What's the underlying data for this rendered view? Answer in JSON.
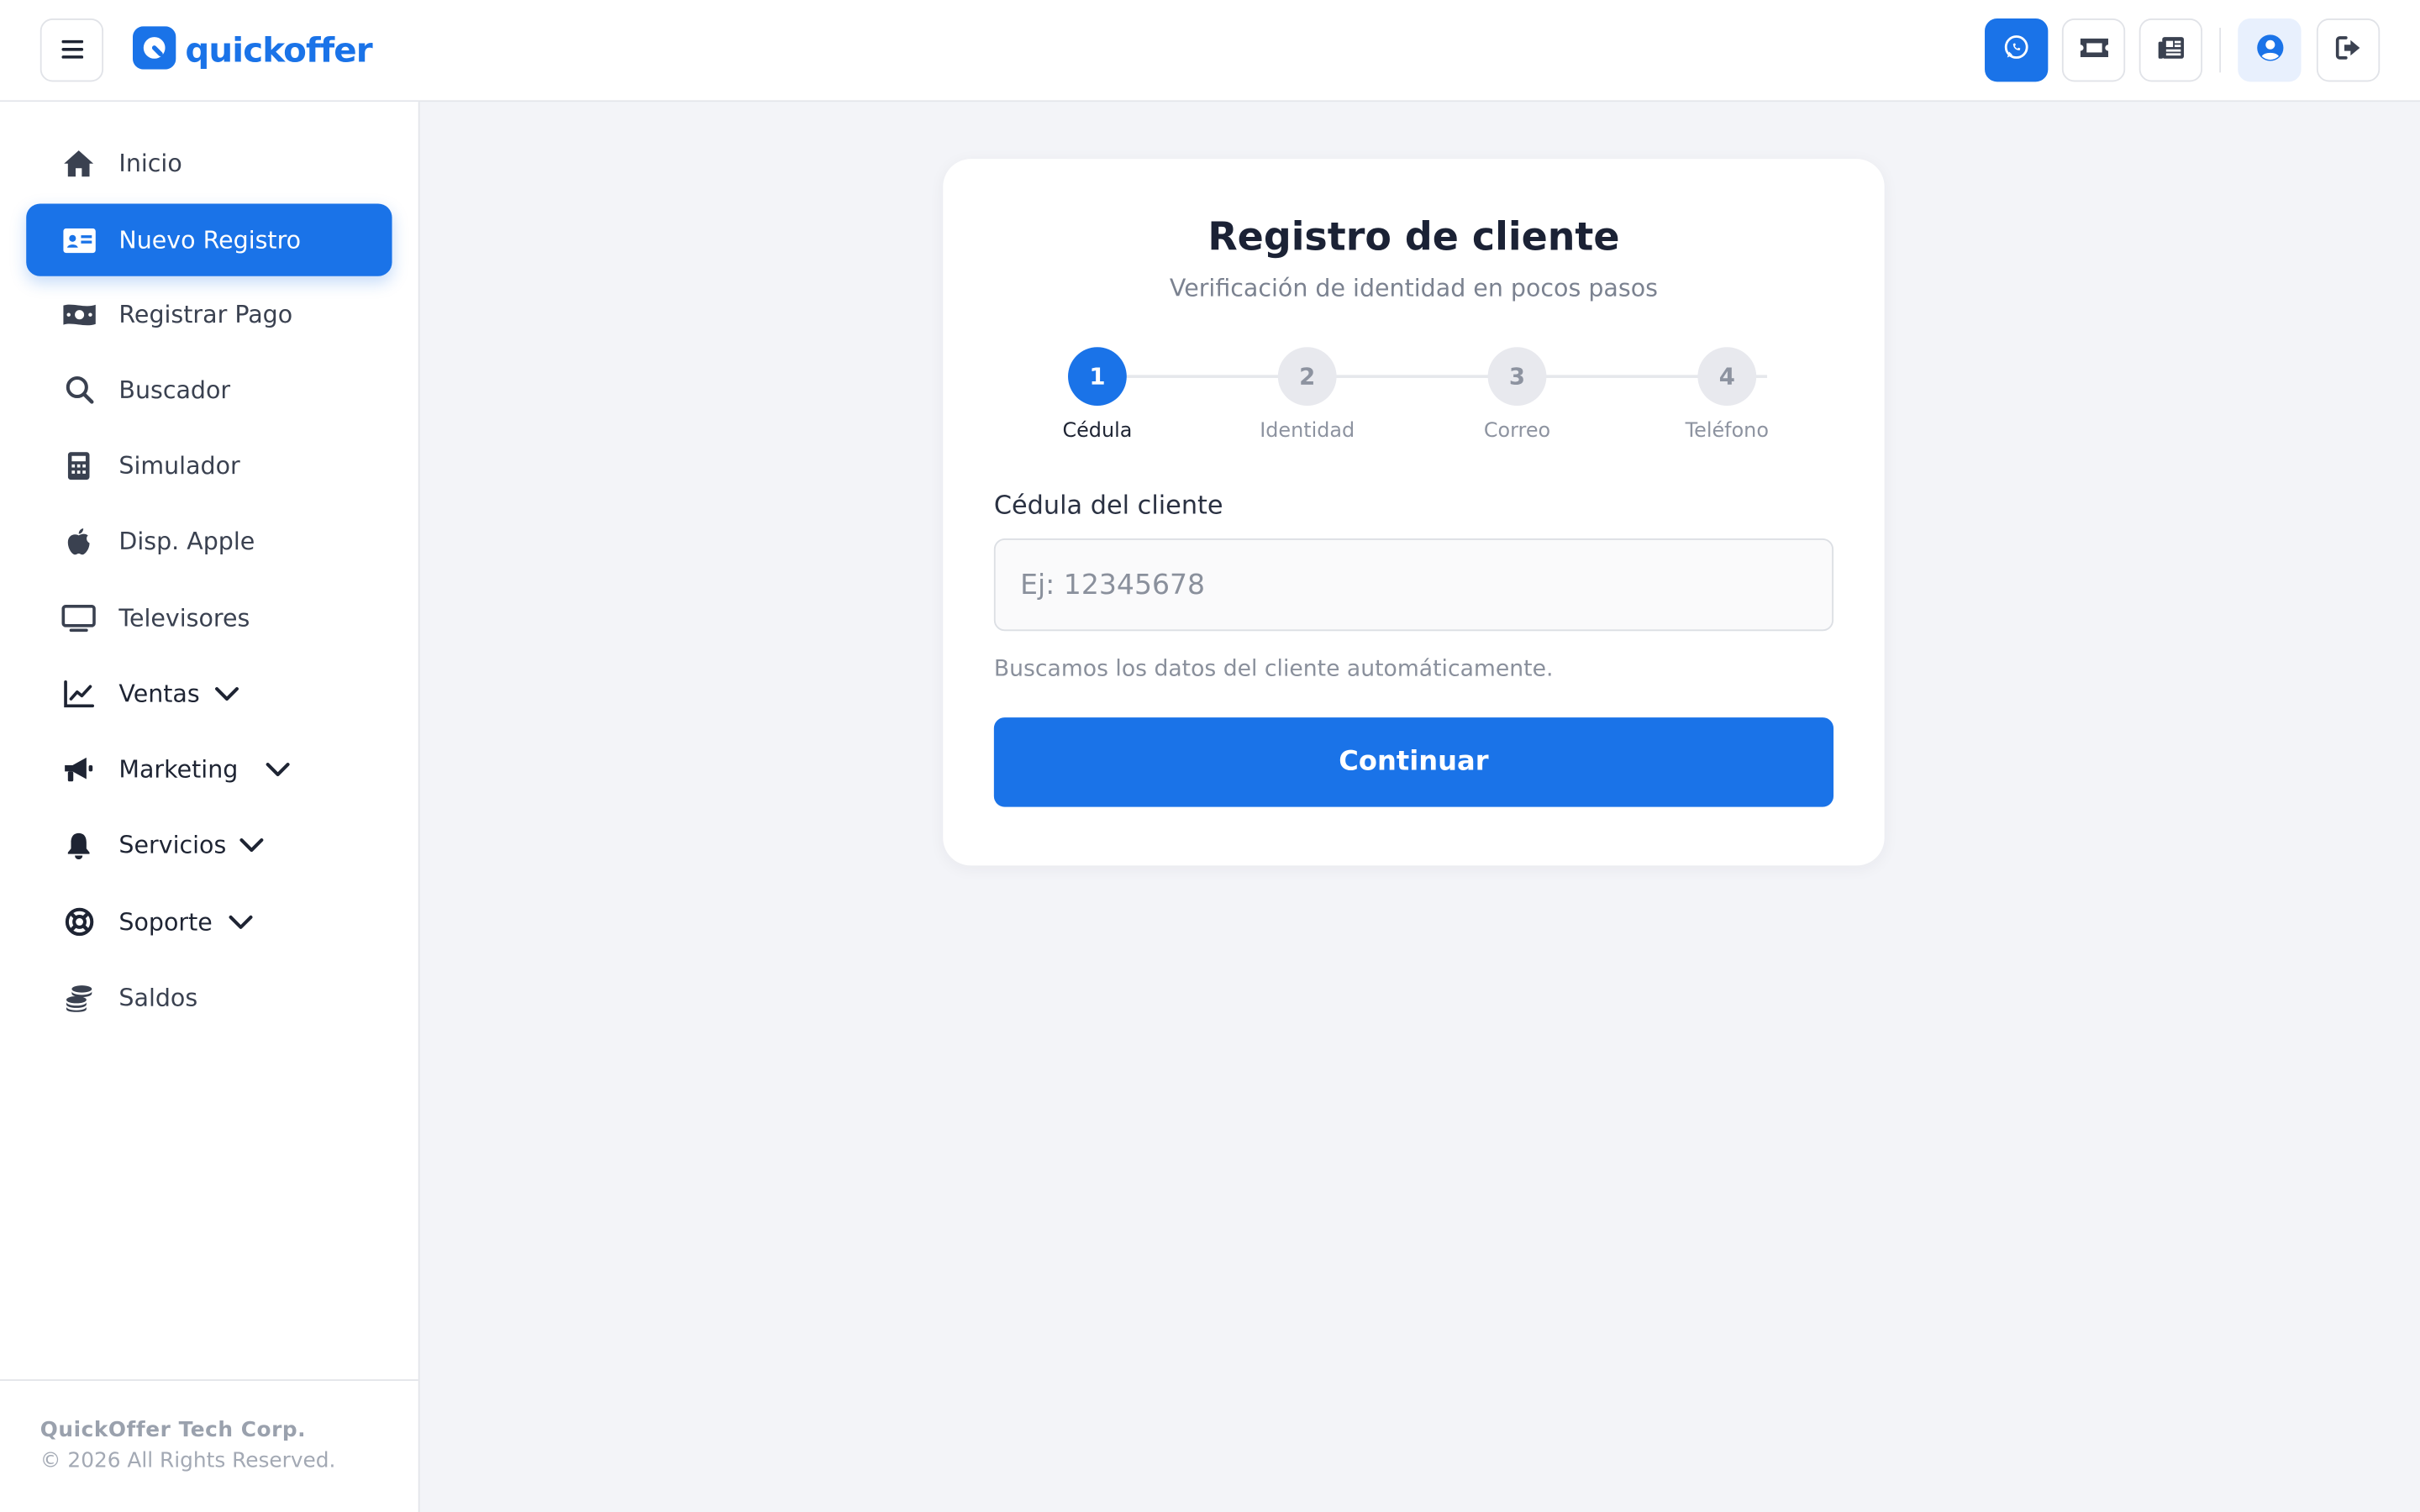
{
  "header": {
    "logo_text": "quickoffer",
    "brand_color": "#1a73e8",
    "actions": [
      {
        "name": "whatsapp-icon"
      },
      {
        "name": "ticket-icon"
      },
      {
        "name": "newspaper-icon"
      },
      {
        "name": "user-circle-icon"
      },
      {
        "name": "logout-icon"
      }
    ]
  },
  "sidebar": {
    "items": [
      {
        "label": "Inicio",
        "icon": "home-icon"
      },
      {
        "label": "Nuevo Registro",
        "icon": "id-card-icon",
        "active": true
      },
      {
        "label": "Registrar Pago",
        "icon": "money-icon"
      },
      {
        "label": "Buscador",
        "icon": "search-icon"
      },
      {
        "label": "Simulador",
        "icon": "calculator-icon"
      },
      {
        "label": "Disp. Apple",
        "icon": "apple-icon"
      },
      {
        "label": "Televisores",
        "icon": "tv-icon"
      },
      {
        "label": "Ventas",
        "icon": "chart-line-icon",
        "expandable": true
      },
      {
        "label": "Marketing",
        "icon": "megaphone-icon",
        "expandable": true
      },
      {
        "label": "Servicios",
        "icon": "bell-icon",
        "expandable": true
      },
      {
        "label": "Soporte",
        "icon": "lifebuoy-icon",
        "expandable": true
      },
      {
        "label": "Saldos",
        "icon": "coins-icon"
      }
    ],
    "footer": {
      "company": "QuickOffer Tech Corp.",
      "copyright": "© 2026 All Rights Reserved."
    }
  },
  "main": {
    "title": "Registro de cliente",
    "subtitle": "Verificación de identidad en pocos pasos",
    "steps": [
      {
        "number": "1",
        "label": "Cédula",
        "active": true
      },
      {
        "number": "2",
        "label": "Identidad"
      },
      {
        "number": "3",
        "label": "Correo"
      },
      {
        "number": "4",
        "label": "Teléfono"
      }
    ],
    "field": {
      "label": "Cédula del cliente",
      "placeholder": "Ej: 12345678",
      "value": "",
      "help": "Buscamos los datos del cliente automáticamente."
    },
    "continue_label": "Continuar"
  }
}
